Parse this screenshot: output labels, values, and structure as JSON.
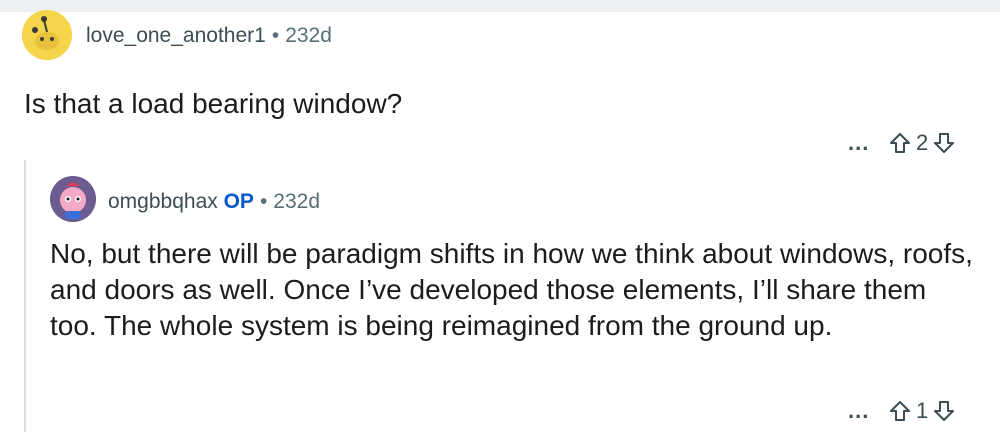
{
  "comments": [
    {
      "username": "love_one_another1",
      "age": "232d",
      "body": "Is that a load bearing window?",
      "score": "2",
      "more": "..."
    },
    {
      "username": "omgbbqhax",
      "op_badge": "OP",
      "age": "232d",
      "body": "No, but there will be paradigm shifts in how we think about windows, roofs, and doors as well. Once I’ve developed those elements, I’ll share them too. The whole system is being reimagined from the ground up.",
      "score": "1",
      "more": "..."
    }
  ],
  "meta_separator": "•",
  "colors": {
    "avatar1": "#f5d64a",
    "avatar2": "#6d5c8f",
    "op": "#0a58c8",
    "meta": "#576f76"
  }
}
